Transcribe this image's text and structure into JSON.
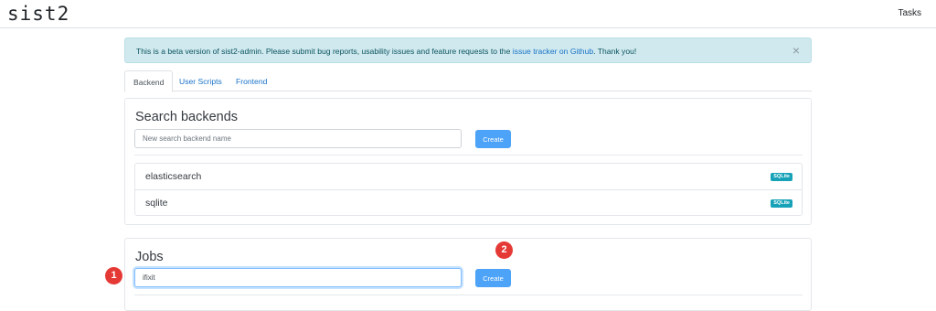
{
  "navbar": {
    "brand": "sist2",
    "tasks_label": "Tasks"
  },
  "alert": {
    "text_before": "This is a beta version of sist2-admin. Please submit bug reports, usability issues and feature requests to the ",
    "link_text": "issue tracker on Github",
    "text_after": ". Thank you!",
    "close_symbol": "×"
  },
  "tabs": [
    {
      "label": "Backend",
      "active": true
    },
    {
      "label": "User Scripts",
      "active": false
    },
    {
      "label": "Frontend",
      "active": false
    }
  ],
  "search_backends": {
    "title": "Search backends",
    "input_placeholder": "New search backend name",
    "create_label": "Create",
    "items": [
      {
        "name": "elasticsearch",
        "badge": "SQLite"
      },
      {
        "name": "sqlite",
        "badge": "SQLite"
      }
    ]
  },
  "jobs": {
    "title": "Jobs",
    "input_value": "ifixit",
    "create_label": "Create"
  },
  "annotations": {
    "marker_1": "1",
    "marker_2": "2",
    "color": "#e53935"
  }
}
